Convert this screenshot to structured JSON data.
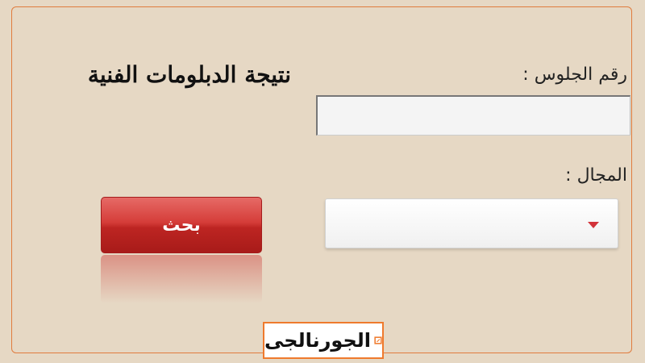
{
  "page_title": "نتيجة الدبلومات الفنية",
  "form": {
    "seat_number_label": "رقم الجلوس :",
    "seat_number_value": "",
    "field_label": "المجال :",
    "field_selected": ""
  },
  "search_button_label": "بحث",
  "logo": {
    "text": "الجورنالجى",
    "accent_color": "#ef7a2d"
  },
  "colors": {
    "background": "#e6d8c4",
    "border": "#e07c3e",
    "button": "#c8302c",
    "chevron": "#d2333a"
  },
  "icons": {
    "dropdown": "chevron-down-icon",
    "logo": "logo-icon"
  }
}
